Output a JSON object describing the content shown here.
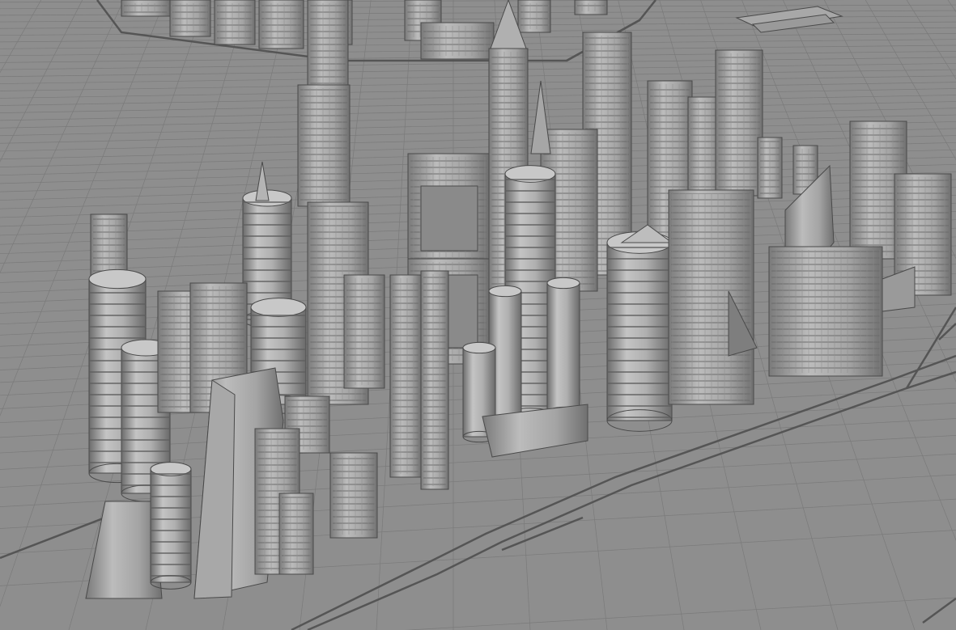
{
  "viewport": {
    "description_visible_text": "",
    "colors": {
      "ground": "#8e8e8e",
      "grid_line": "#7a7a7a",
      "road_line": "#555555",
      "building_light": "#bdbdbd",
      "building_mid": "#a2a2a2",
      "building_dark": "#6e6e6e",
      "outline": "#4a4a4a"
    }
  }
}
